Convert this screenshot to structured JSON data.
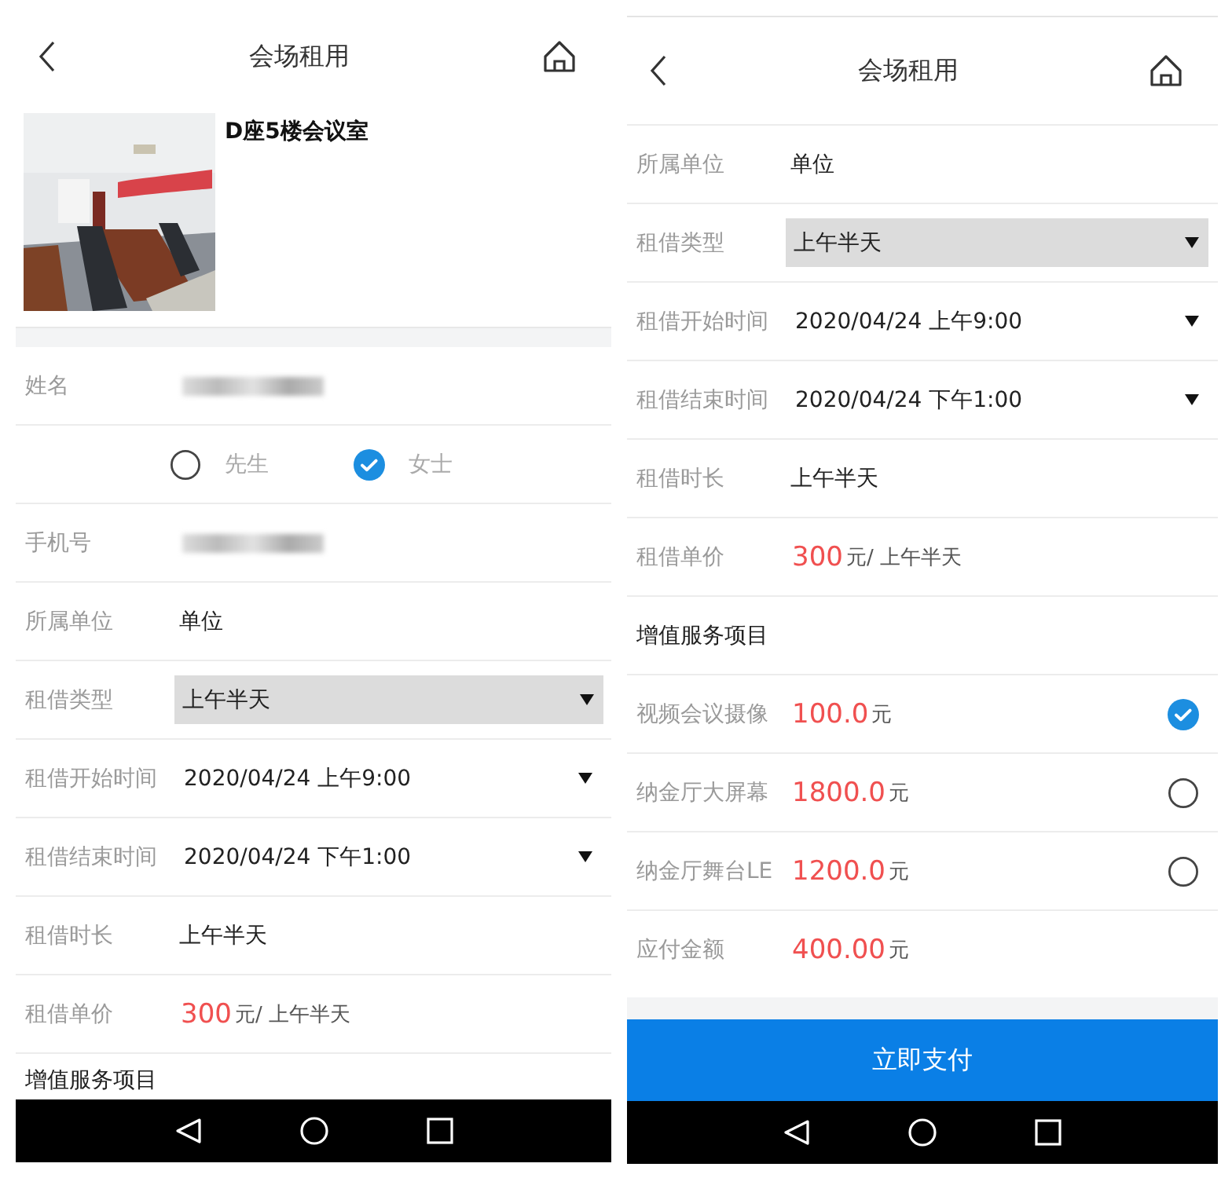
{
  "screens": [
    {
      "header": {
        "title": "会场租用"
      },
      "venue": {
        "kind": "picture",
        "name": "D座5楼会议室"
      },
      "rows": [
        {
          "kind": "blurred",
          "label": "姓名"
        },
        {
          "kind": "radio",
          "options": [
            {
              "label": "先生",
              "selected": false
            },
            {
              "label": "女士",
              "selected": true
            }
          ]
        },
        {
          "kind": "blurred",
          "label": "手机号"
        },
        {
          "kind": "text",
          "label": "所属单位",
          "value": "单位"
        },
        {
          "kind": "select",
          "label": "租借类型",
          "value": "上午半天"
        },
        {
          "kind": "picker",
          "label": "租借开始时间",
          "value": "2020/04/24 上午9:00"
        },
        {
          "kind": "picker",
          "label": "租借结束时间",
          "value": "2020/04/24 下午1:00"
        },
        {
          "kind": "text",
          "label": "租借时长",
          "value": "上午半天"
        },
        {
          "kind": "price",
          "label": "租借单价",
          "amount": "300",
          "unit": "元/ 上午半天"
        },
        {
          "kind": "section",
          "label": "增值服务项目"
        }
      ]
    },
    {
      "header": {
        "title": "会场租用"
      },
      "rows": [
        {
          "kind": "text",
          "label": "所属单位",
          "value": "单位"
        },
        {
          "kind": "select",
          "label": "租借类型",
          "value": "上午半天"
        },
        {
          "kind": "picker",
          "label": "租借开始时间",
          "value": "2020/04/24 上午9:00"
        },
        {
          "kind": "picker",
          "label": "租借结束时间",
          "value": "2020/04/24 下午1:00"
        },
        {
          "kind": "text",
          "label": "租借时长",
          "value": "上午半天"
        },
        {
          "kind": "price",
          "label": "租借单价",
          "amount": "300",
          "unit": "元/ 上午半天"
        },
        {
          "kind": "section",
          "label": "增值服务项目"
        },
        {
          "kind": "service",
          "label": "视频会议摄像",
          "amount": "100.0",
          "unit": "元",
          "checked": true
        },
        {
          "kind": "service",
          "label": "纳金厅大屏幕",
          "amount": "1800.0",
          "unit": "元",
          "checked": false
        },
        {
          "kind": "service",
          "label": "纳金厅舞台LE",
          "amount": "1200.0",
          "unit": "元",
          "checked": false
        },
        {
          "kind": "total",
          "label": "应付金额",
          "amount": "400.00",
          "unit": "元"
        }
      ],
      "pay_button": {
        "label": "立即支付"
      }
    }
  ]
}
